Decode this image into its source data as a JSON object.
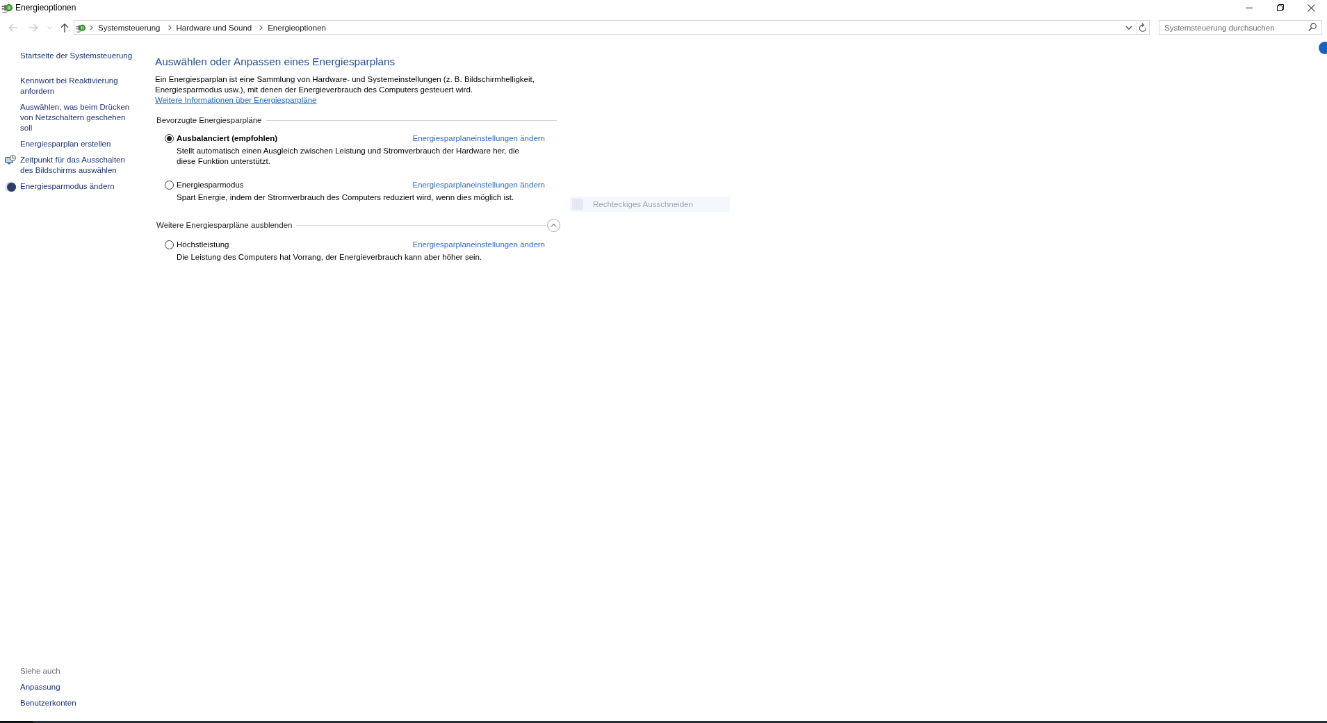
{
  "window": {
    "title": "Energieoptionen"
  },
  "navigation": {
    "back": {
      "disabled": true
    },
    "forward": {
      "disabled": true
    },
    "recent": {
      "disabled": true
    },
    "up": {
      "disabled": false
    }
  },
  "address_bar": {
    "breadcrumbs": [
      "Systemsteuerung",
      "Hardware und Sound",
      "Energieoptionen"
    ]
  },
  "search": {
    "placeholder": "Systemsteuerung durchsuchen"
  },
  "sidebar": {
    "items": [
      {
        "kind": "home",
        "label": "Startseite der Systemsteuerung"
      },
      {
        "kind": "link",
        "label": "Kennwort bei Reaktivierung anfordern"
      },
      {
        "kind": "link",
        "label": "Auswählen, was beim Drücken von Netzschaltern geschehen soll"
      },
      {
        "kind": "link",
        "label": "Energiesparplan erstellen"
      },
      {
        "kind": "display-link",
        "label": "Zeitpunkt für das Ausschalten des Bildschirms auswählen"
      },
      {
        "kind": "sleep-link",
        "label": "Energiesparmodus ändern"
      }
    ],
    "see_also": {
      "title": "Siehe auch",
      "links": [
        "Anpassung",
        "Benutzerkonten"
      ]
    }
  },
  "main": {
    "title": "Auswählen oder Anpassen eines Energiesparplans",
    "description": "Ein Energiesparplan ist eine Sammlung von Hardware- und Systemeinstellungen (z. B. Bildschirmhelligkeit, Energiesparmodus usw.), mit denen der Energieverbrauch des Computers gesteuert wird.",
    "more_info_link": "Weitere Informationen über Energiesparpläne",
    "sections": [
      {
        "title": "Bevorzugte Energiesparpläne",
        "plans": [
          {
            "name": "Ausbalanciert (empfohlen)",
            "selected": true,
            "link": "Energiesparplaneinstellungen ändern",
            "description": "Stellt automatisch einen Ausgleich zwischen Leistung und Stromverbrauch der Hardware her, die diese Funktion unterstützt."
          },
          {
            "name": "Energiesparmodus",
            "selected": false,
            "link": "Energiesparplaneinstellungen ändern",
            "description": "Spart Energie, indem der Stromverbrauch des Computers reduziert wird, wenn dies möglich ist."
          }
        ]
      },
      {
        "title": "Weitere Energiesparpläne ausblenden",
        "expanded": true,
        "plans": [
          {
            "name": "Höchstleistung",
            "selected": false,
            "link": "Energiesparplaneinstellungen ändern",
            "description": "Die Leistung des Computers hat Vorrang, der Energieverbrauch kann aber höher sein."
          }
        ]
      }
    ]
  },
  "tooltip": {
    "text": "Rechteckiges Ausschneiden"
  }
}
